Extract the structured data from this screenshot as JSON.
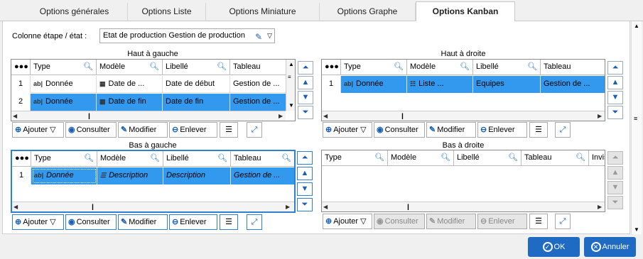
{
  "tabs": [
    {
      "label": "Options générales"
    },
    {
      "label": "Options Liste"
    },
    {
      "label": "Options Miniature"
    },
    {
      "label": "Options Graphe"
    },
    {
      "label": "Options Kanban"
    }
  ],
  "column_stage": {
    "label": "Colonne étape / état :",
    "value": "Etat de production Gestion de production"
  },
  "quadrants": {
    "top_left": {
      "title": "Haut à gauche",
      "headers": [
        "Type",
        "Modèle",
        "Libellé",
        "Tableau"
      ],
      "rows": [
        [
          "1",
          "Donnée",
          "Date de ...",
          "Date de début",
          "Gestion de ..."
        ],
        [
          "2",
          "Donnée",
          "Date de fin",
          "Date de fin",
          "Gestion de ..."
        ]
      ]
    },
    "top_right": {
      "title": "Haut à droite",
      "headers": [
        "Type",
        "Modèle",
        "Libellé",
        "Tableau"
      ],
      "rows": [
        [
          "1",
          "Donnée",
          "Liste ...",
          "Equipes",
          "Gestion de ..."
        ]
      ]
    },
    "bottom_left": {
      "title": "Bas à gauche",
      "headers": [
        "Type",
        "Modèle",
        "Libellé",
        "Tableau"
      ],
      "rows": [
        [
          "1",
          "Donnée",
          "Description",
          "Description",
          "Gestion de ..."
        ]
      ]
    },
    "bottom_right": {
      "title": "Bas à droite",
      "headers": [
        "Type",
        "Modèle",
        "Libellé",
        "Tableau",
        "Invis"
      ]
    }
  },
  "toolbar": {
    "add": "Ajouter",
    "view": "Consulter",
    "edit": "Modifier",
    "remove": "Enlever"
  },
  "actions": {
    "ok": "OK",
    "cancel": "Annuler"
  },
  "colors": {
    "accent": "#1f6bc4",
    "selection": "#3399ee"
  }
}
